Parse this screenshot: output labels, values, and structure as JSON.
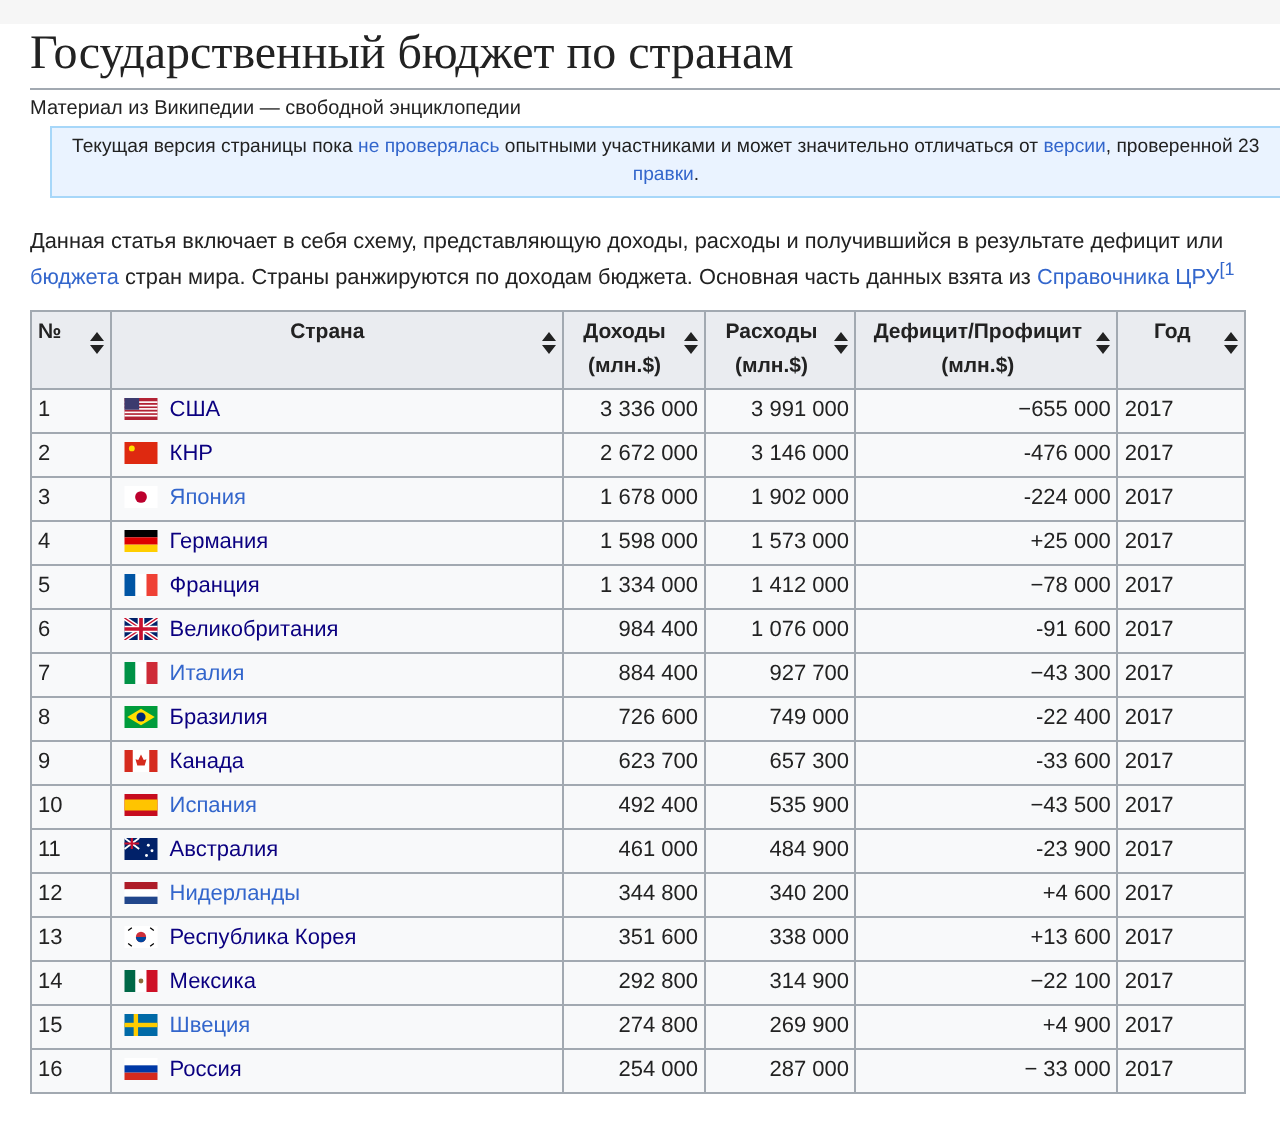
{
  "page": {
    "title": "Государственный бюджет по странам",
    "subtitle": "Материал из Википедии — свободной энциклопедии"
  },
  "notice": {
    "lines": [
      [
        {
          "kind": "text",
          "text": "Текущая версия страницы пока"
        },
        {
          "kind": "link",
          "text": "не проверялась"
        },
        {
          "kind": "text",
          "text": "опытными участниками и может значительно отличаться от"
        },
        {
          "kind": "link",
          "text": "версии"
        },
        {
          "kind": "text",
          "text": ", проверенной 23"
        }
      ],
      [
        {
          "kind": "link",
          "text": "правки"
        },
        {
          "kind": "text",
          "text": "."
        }
      ]
    ]
  },
  "intro": {
    "lines": [
      [
        {
          "kind": "text",
          "text": "Данная статья включает в себя схему, представляющую доходы, расходы и получившийся в результате дефицит или"
        }
      ],
      [
        {
          "kind": "link",
          "text": "бюджета"
        },
        {
          "kind": "text",
          "text": "стран мира. Страны ранжируются по доходам бюджета. Основная часть данных взята из"
        },
        {
          "kind": "link",
          "text": "Справочника ЦРУ"
        },
        {
          "kind": "ref",
          "text": "[1"
        }
      ]
    ]
  },
  "table": {
    "columns": [
      {
        "label": "№"
      },
      {
        "label": "Страна"
      },
      {
        "label": "Доходы (млн.$)"
      },
      {
        "label": "Расходы (млн.$)"
      },
      {
        "label": "Дефицит/Профицит (млн.$)"
      },
      {
        "label": "Год"
      }
    ],
    "rows": [
      {
        "rank": "1",
        "kind": "us",
        "country": "США",
        "visited": true,
        "revenue": "3 336 000",
        "expenses": "3 991 000",
        "balance": "−655 000",
        "year": "2017"
      },
      {
        "rank": "2",
        "kind": "cn",
        "country": "КНР",
        "visited": true,
        "revenue": "2 672 000",
        "expenses": "3 146 000",
        "balance": "-476 000",
        "year": "2017"
      },
      {
        "rank": "3",
        "kind": "jp",
        "country": "Япония",
        "visited": false,
        "revenue": "1 678 000",
        "expenses": "1 902 000",
        "balance": "-224 000",
        "year": "2017"
      },
      {
        "rank": "4",
        "kind": "de",
        "country": "Германия",
        "visited": true,
        "revenue": "1 598 000",
        "expenses": "1 573 000",
        "balance": "+25 000",
        "year": "2017"
      },
      {
        "rank": "5",
        "kind": "fr",
        "country": "Франция",
        "visited": true,
        "revenue": "1 334 000",
        "expenses": "1 412 000",
        "balance": "−78 000",
        "year": "2017"
      },
      {
        "rank": "6",
        "kind": "gb",
        "country": "Великобритания",
        "visited": true,
        "revenue": "984 400",
        "expenses": "1 076 000",
        "balance": "-91 600",
        "year": "2017"
      },
      {
        "rank": "7",
        "kind": "it",
        "country": "Италия",
        "visited": false,
        "revenue": "884 400",
        "expenses": "927 700",
        "balance": "−43 300",
        "year": "2017"
      },
      {
        "rank": "8",
        "kind": "br",
        "country": "Бразилия",
        "visited": true,
        "revenue": "726 600",
        "expenses": "749 000",
        "balance": "-22 400",
        "year": "2017"
      },
      {
        "rank": "9",
        "kind": "ca",
        "country": "Канада",
        "visited": true,
        "revenue": "623 700",
        "expenses": "657 300",
        "balance": "-33 600",
        "year": "2017"
      },
      {
        "rank": "10",
        "kind": "es",
        "country": "Испания",
        "visited": false,
        "revenue": "492 400",
        "expenses": "535 900",
        "balance": "−43 500",
        "year": "2017"
      },
      {
        "rank": "11",
        "kind": "au",
        "country": "Австралия",
        "visited": true,
        "revenue": "461 000",
        "expenses": "484 900",
        "balance": "-23 900",
        "year": "2017"
      },
      {
        "rank": "12",
        "kind": "nl",
        "country": "Нидерланды",
        "visited": false,
        "revenue": "344 800",
        "expenses": "340 200",
        "balance": "+4 600",
        "year": "2017"
      },
      {
        "rank": "13",
        "kind": "kr",
        "country": "Республика Корея",
        "visited": true,
        "revenue": "351 600",
        "expenses": "338 000",
        "balance": "+13 600",
        "year": "2017"
      },
      {
        "rank": "14",
        "kind": "mx",
        "country": "Мексика",
        "visited": true,
        "revenue": "292 800",
        "expenses": "314 900",
        "balance": "−22 100",
        "year": "2017"
      },
      {
        "rank": "15",
        "kind": "se",
        "country": "Швеция",
        "visited": false,
        "revenue": "274 800",
        "expenses": "269 900",
        "balance": "+4 900",
        "year": "2017"
      },
      {
        "rank": "16",
        "kind": "ru",
        "country": "Россия",
        "visited": true,
        "revenue": "254 000",
        "expenses": "287 000",
        "balance": "− 33 000",
        "year": "2017"
      }
    ]
  }
}
